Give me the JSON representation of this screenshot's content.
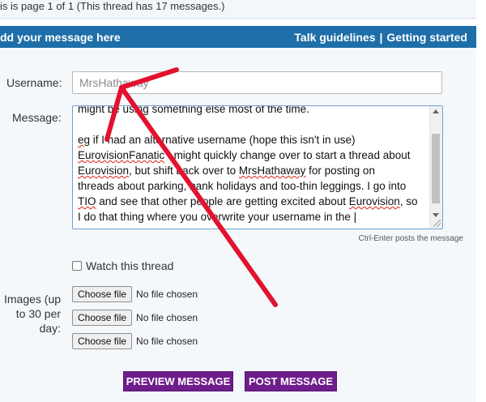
{
  "page_info": "is is page 1 of 1 (This thread has 17 messages.)",
  "header": {
    "title": "dd your message here",
    "link_guidelines": "Talk guidelines",
    "separator": "|",
    "link_getting_started": "Getting started"
  },
  "form": {
    "username_label": "Username:",
    "username_value": "MrsHathaway",
    "message_label": "Message:",
    "message_lines": [
      "might be using something else most of the time.",
      "",
      "eg if I had an alternative username (hope this isn't in use)",
      "EurovisionFanatic I might quickly change over to start a thread about",
      "Eurovision, but shift back over to MrsHathaway for posting on",
      "threads about parking, bank holidays and too-thin leggings. I go into",
      "TIO and see that other people are getting excited about Eurovision, so",
      "I do that thing where you overwrite your username in the |"
    ],
    "hint": "Ctrl-Enter posts the message",
    "watch_label": "Watch this thread",
    "images_label_lines": [
      "Images (up",
      "to 30 per",
      "day:"
    ],
    "file_inputs": [
      {
        "button": "Choose file",
        "status": "No file chosen"
      },
      {
        "button": "Choose file",
        "status": "No file chosen"
      },
      {
        "button": "Choose file",
        "status": "No file chosen"
      }
    ],
    "preview_button": "PREVIEW MESSAGE",
    "post_button": "POST MESSAGE"
  },
  "colors": {
    "header_bg": "#1e6ea9",
    "button_bg": "#6f1d8c",
    "annotation_arrow": "#e3122f"
  }
}
